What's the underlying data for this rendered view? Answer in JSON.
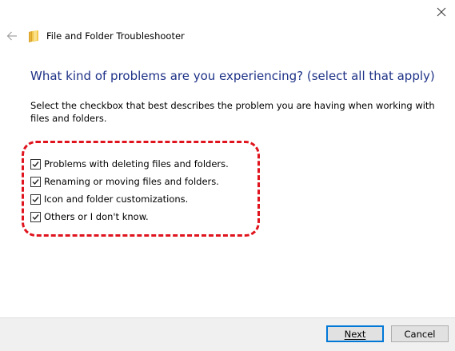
{
  "window": {
    "title": "File and Folder Troubleshooter",
    "back_icon": "arrow-left-icon",
    "close_icon": "close-icon",
    "app_icon": "folder-icon"
  },
  "content": {
    "heading": "What kind of problems are you experiencing? (select all that apply)",
    "description": "Select the checkbox that best describes the problem you are having when working with files and folders.",
    "options": [
      {
        "label": "Problems with deleting files and folders.",
        "checked": true
      },
      {
        "label": "Renaming or moving files and folders.",
        "checked": true
      },
      {
        "label": "Icon and folder customizations.",
        "checked": true
      },
      {
        "label": "Others or I don't know.",
        "checked": true
      }
    ]
  },
  "footer": {
    "next_label": "Next",
    "cancel_label": "Cancel"
  },
  "colors": {
    "heading": "#1e3287",
    "highlight": "#e0141e",
    "accent": "#0078d7"
  }
}
